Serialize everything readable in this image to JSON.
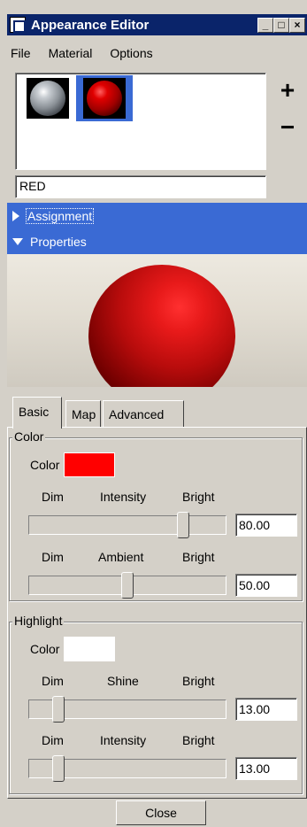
{
  "window": {
    "title": "Appearance Editor"
  },
  "menu": {
    "file": "File",
    "material": "Material",
    "options": "Options"
  },
  "materials": {
    "items": [
      {
        "name": "grey-material"
      },
      {
        "name": "red-material",
        "selected": true
      }
    ],
    "add_label": "+",
    "remove_label": "−",
    "name_value": "RED"
  },
  "sections": {
    "assignment": "Assignment",
    "properties": "Properties"
  },
  "tabs": {
    "basic": "Basic",
    "map": "Map",
    "advanced": "Advanced"
  },
  "color_group": {
    "title": "Color",
    "color_label": "Color",
    "swatch_color": "#ff0000",
    "intensity": {
      "dim": "Dim",
      "label": "Intensity",
      "bright": "Bright",
      "value": "80.00",
      "level": 0.8
    },
    "ambient": {
      "dim": "Dim",
      "label": "Ambient",
      "bright": "Bright",
      "value": "50.00",
      "level": 0.5
    }
  },
  "highlight_group": {
    "title": "Highlight",
    "color_label": "Color",
    "swatch_color": "#ffffff",
    "shine": {
      "dim": "Dim",
      "label": "Shine",
      "bright": "Bright",
      "value": "13.00",
      "level": 0.13
    },
    "intensity": {
      "dim": "Dim",
      "label": "Intensity",
      "bright": "Bright",
      "value": "13.00",
      "level": 0.13
    }
  },
  "buttons": {
    "close": "Close"
  },
  "colors": {
    "selection": "#3a6ad4",
    "titlebar": "#0a246a"
  }
}
